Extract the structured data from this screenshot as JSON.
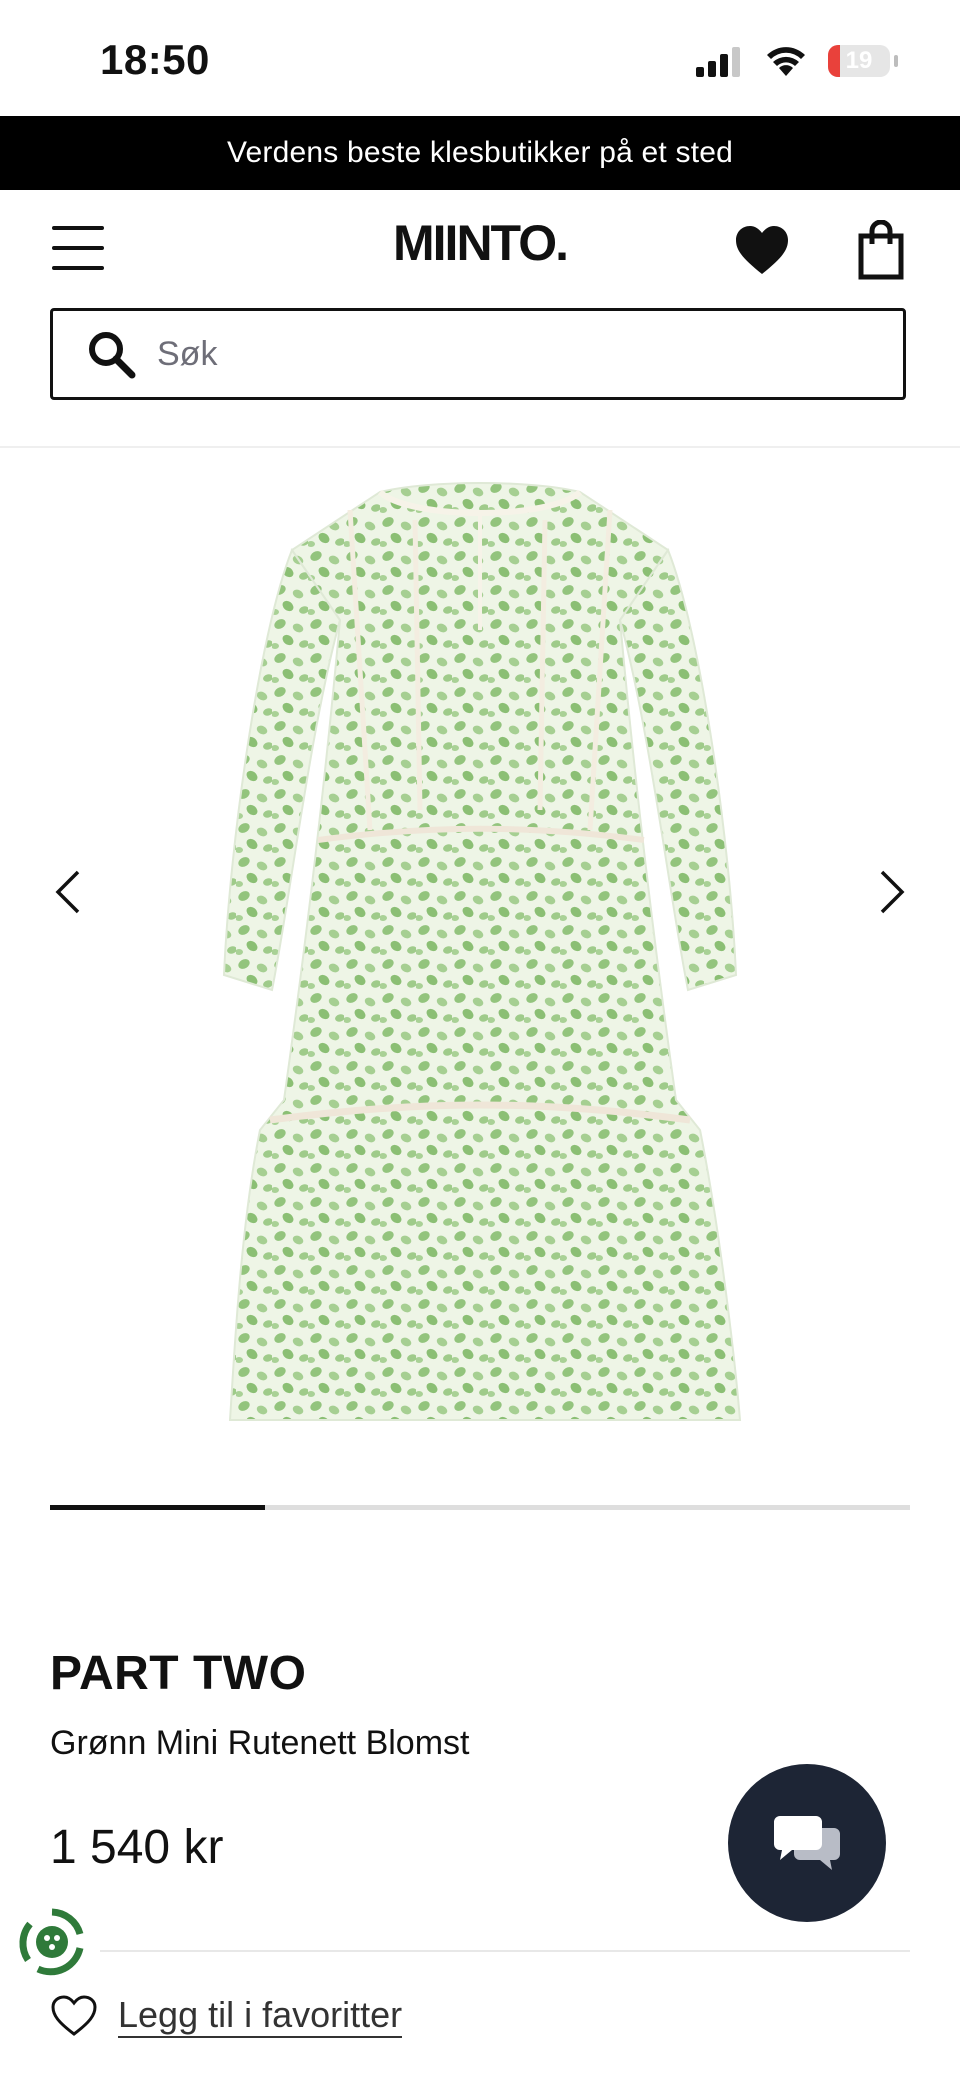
{
  "status_bar": {
    "time": "18:50",
    "battery": "19"
  },
  "promo_banner": {
    "text": "Verdens beste klesbutikker på et sted"
  },
  "header": {
    "logo": "MIINTO."
  },
  "search": {
    "placeholder": "Søk"
  },
  "carousel": {
    "progress": 0.25
  },
  "product": {
    "brand": "PART TWO",
    "name": "Grønn Mini Rutenett Blomst",
    "price": "1 540 kr"
  },
  "favorites": {
    "label": "Legg til i favoritter"
  },
  "colors": {
    "accent_dark": "#1d2535",
    "battery_low": "#e9413b",
    "dress_green": "#8dc27a"
  }
}
